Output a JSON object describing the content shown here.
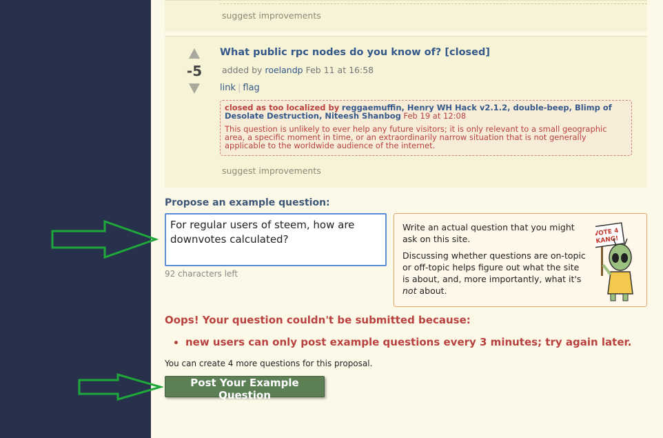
{
  "previous_question": {
    "suggest_label": "suggest improvements"
  },
  "question": {
    "vote_count": "-5",
    "title": "What public rpc nodes do you know of? [closed]",
    "added_by_prefix": "added by",
    "author": "roelandp",
    "date": "Feb 11 at 16:58",
    "link_label": "link",
    "flag_label": "flag",
    "closed_prefix": "closed as too localized by",
    "closed_voters": "reggaemuffin, Henry WH Hack v2.1.2, double-beep, Blimp of Desolate Destruction, Niteesh Shanbog",
    "closed_date": "Feb 19 at 12:08",
    "closed_reason": "This question is unlikely to ever help any future visitors; it is only relevant to a small geographic area, a specific moment in time, or an extraordinarily narrow situation that is not generally applicable to the worldwide audience of the internet.",
    "suggest_label": "suggest improvements"
  },
  "propose": {
    "label": "Propose an example question:",
    "input_value": "For regular users of steem, how are downvotes calculated?",
    "chars_left": "92 characters left"
  },
  "help": {
    "text1": "Write an actual question that you might ask on this site.",
    "text2_a": "Discussing whether questions are on-topic or off-topic helps figure out what the site is about, and, more importantly, what it's",
    "text2_em": "not",
    "text2_b": "about.",
    "mascot_sign": [
      "VOTE 4",
      "KANG!"
    ],
    "mascot_icon": "alien-mascot-icon"
  },
  "error": {
    "title": "Oops! Your question couldn't be submitted because:",
    "items": [
      "new users can only post example questions every 3 minutes; try again later."
    ]
  },
  "create_more": "You can create 4 more questions for this proposal.",
  "post_button": "Post Your Example Question",
  "colors": {
    "sidebar": "#27314b",
    "page_bg": "#fdf9e8",
    "card_bg": "#f6f3d6",
    "link": "#34588a",
    "error": "#b8413f",
    "button": "#5c7f55",
    "annotation_arrow": "#1fa83a"
  }
}
